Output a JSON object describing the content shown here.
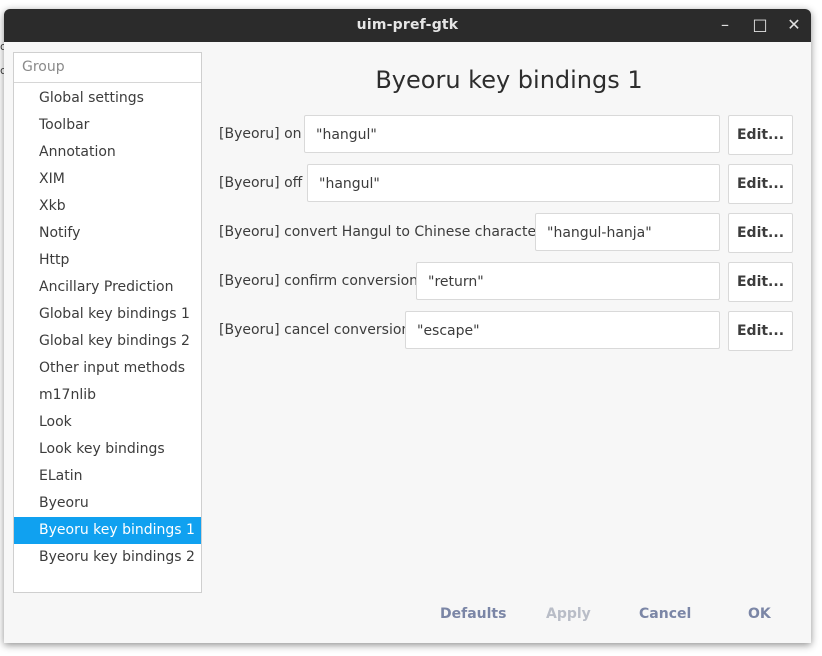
{
  "window": {
    "title": "uim-pref-gtk",
    "controls": {
      "minimize": "–",
      "maximize": "□",
      "close": "✕"
    }
  },
  "sidebar": {
    "header": "Group",
    "items": [
      {
        "label": "Global settings"
      },
      {
        "label": "Toolbar"
      },
      {
        "label": "Annotation"
      },
      {
        "label": "XIM"
      },
      {
        "label": "Xkb"
      },
      {
        "label": "Notify"
      },
      {
        "label": "Http"
      },
      {
        "label": "Ancillary Prediction"
      },
      {
        "label": "Global key bindings 1"
      },
      {
        "label": "Global key bindings 2"
      },
      {
        "label": "Other input methods"
      },
      {
        "label": "m17nlib"
      },
      {
        "label": "Look"
      },
      {
        "label": "Look key bindings"
      },
      {
        "label": "ELatin"
      },
      {
        "label": "Byeoru"
      },
      {
        "label": "Byeoru key bindings 1",
        "selected": true
      },
      {
        "label": "Byeoru key bindings 2"
      }
    ],
    "selected_color": "#10a1f0"
  },
  "main": {
    "title": "Byeoru key bindings 1",
    "bindings": [
      {
        "label": "[Byeoru] on",
        "value": "\"hangul\"",
        "edit_label": "Edit..."
      },
      {
        "label": "[Byeoru] off",
        "value": "\"hangul\"",
        "edit_label": "Edit..."
      },
      {
        "label": "[Byeoru] convert Hangul to Chinese characters",
        "value": "\"hangul-hanja\"",
        "edit_label": "Edit..."
      },
      {
        "label": "[Byeoru] confirm conversion",
        "value": "\"return\"",
        "edit_label": "Edit..."
      },
      {
        "label": "[Byeoru] cancel conversion",
        "value": "\"escape\"",
        "edit_label": "Edit..."
      }
    ]
  },
  "footer": {
    "defaults": "Defaults",
    "apply": "Apply",
    "cancel": "Cancel",
    "ok": "OK"
  },
  "edge_marks": [
    "o",
    "c"
  ]
}
